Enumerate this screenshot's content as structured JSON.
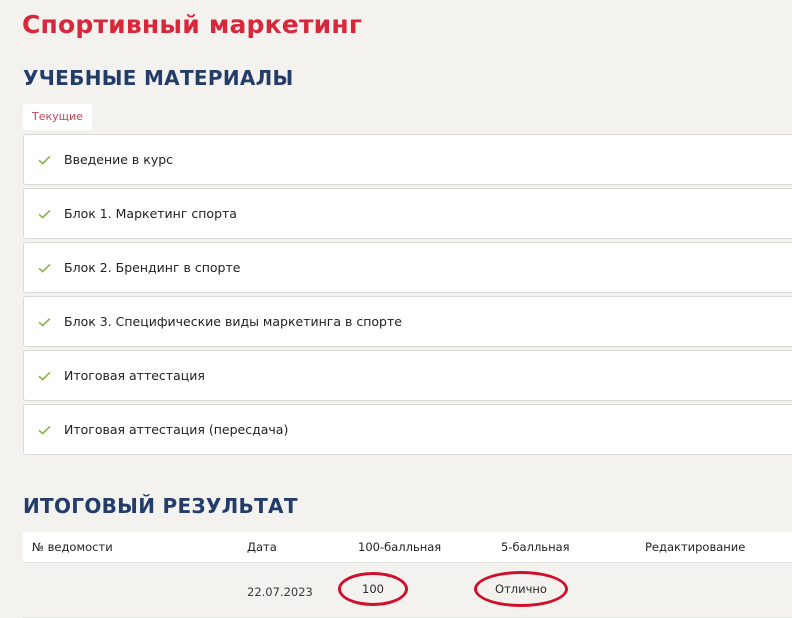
{
  "page": {
    "title": "Спортивный маркетинг"
  },
  "materials": {
    "section_title": "УЧЕБНЫЕ МАТЕРИАЛЫ",
    "tab_label": "Текущие",
    "items": [
      {
        "label": "Введение в курс",
        "status": "completed"
      },
      {
        "label": "Блок 1. Маркетинг спорта",
        "status": "completed"
      },
      {
        "label": "Блок 2. Брендинг в спорте",
        "status": "completed"
      },
      {
        "label": "Блок 3. Специфические виды маркетинга в спорте",
        "status": "completed"
      },
      {
        "label": "Итоговая аттестация",
        "status": "completed"
      },
      {
        "label": "Итоговая аттестация (пересдача)",
        "status": "completed"
      }
    ]
  },
  "results": {
    "section_title": "ИТОГОВЫЙ РЕЗУЛЬТАТ",
    "columns": [
      "№ ведомости",
      "Дата",
      "100-балльная",
      "5-балльная",
      "Редактирование"
    ],
    "rows": [
      {
        "record_no": "",
        "date": "22.07.2023",
        "score_100": "100",
        "score_5": "Отлично",
        "edit": ""
      }
    ]
  },
  "colors": {
    "title_red": "#d8273b",
    "section_navy": "#233c68",
    "check_green": "#8cb44a",
    "annotation_red": "#d0102a",
    "background": "#f3f2ef"
  },
  "icons": {
    "completed": "check-icon"
  }
}
